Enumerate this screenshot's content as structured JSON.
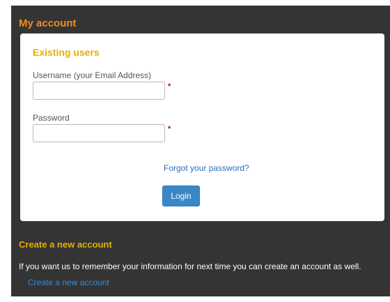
{
  "account": {
    "title": "My account"
  },
  "existing_users": {
    "title": "Existing users",
    "username_label": "Username (your Email Address)",
    "username_value": "",
    "password_label": "Password",
    "password_value": "",
    "required_marker": "*",
    "forgot_link": "Forgot your password?",
    "login_button": "Login"
  },
  "new_account": {
    "title": "Create a new account",
    "description": "If you want us to remember your information for next time you can create an account as well.",
    "link": "Create a new account"
  },
  "colors": {
    "panel_background": "#343434",
    "heading_orange": "#f28c1e",
    "heading_yellow": "#e5b000",
    "link_blue": "#2a6ebb",
    "button_blue": "#3a87c8",
    "required_red": "#cc0000"
  }
}
